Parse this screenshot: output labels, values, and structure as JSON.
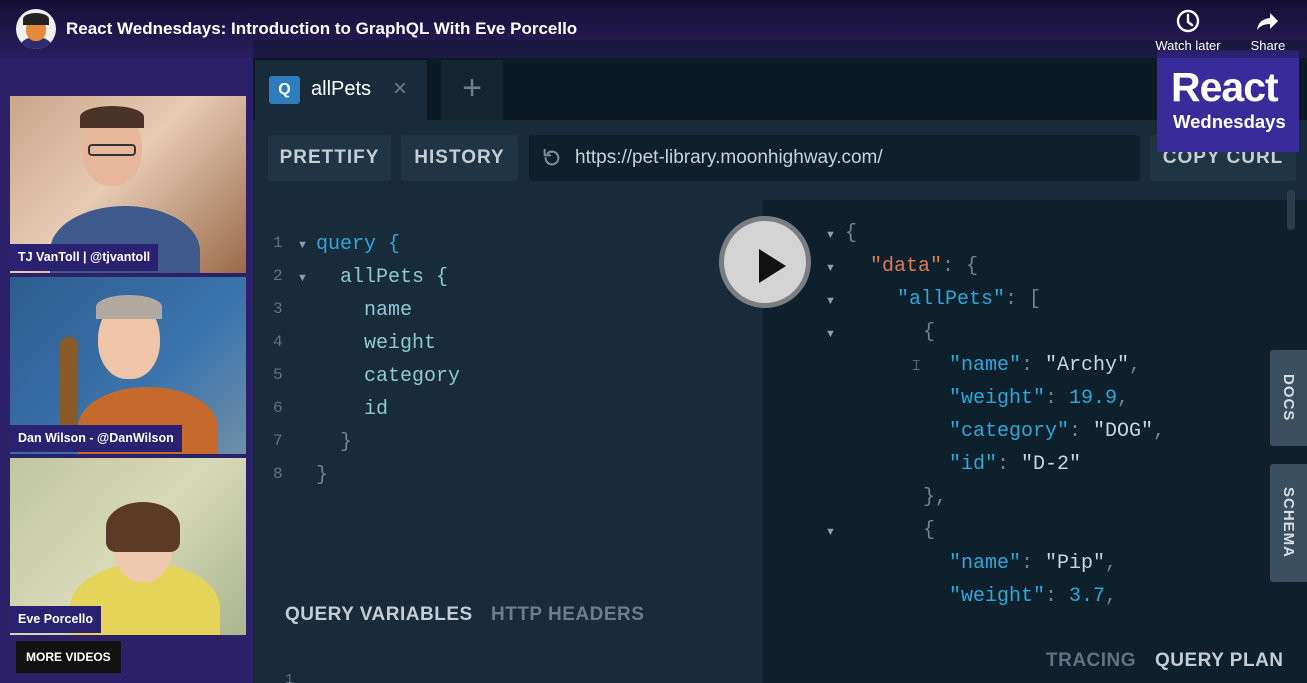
{
  "video": {
    "title": "React Wednesdays: Introduction to GraphQL With Eve Porcello",
    "watch_later_label": "Watch later",
    "share_label": "Share",
    "more_videos_label": "MORE VIDEOS"
  },
  "logo": {
    "line1": "React",
    "line2": "Wednesdays"
  },
  "participants": [
    {
      "name": "TJ VanToll | @tjvantoll"
    },
    {
      "name": "Dan Wilson - @DanWilson"
    },
    {
      "name": "Eve Porcello"
    }
  ],
  "playground": {
    "tab_badge": "Q",
    "tab_label": "allPets",
    "tab_close": "×",
    "add_tab": "+",
    "prettify_label": "PRETTIFY",
    "history_label": "HISTORY",
    "endpoint_url": "https://pet-library.moonhighway.com/",
    "copy_curl_label": "COPY CURL",
    "query_lines": [
      "query {",
      "  allPets {",
      "    name",
      "    weight",
      "    category",
      "    id",
      "  }",
      "}"
    ],
    "line_numbers": [
      "1",
      "2",
      "3",
      "4",
      "5",
      "6",
      "7",
      "8"
    ],
    "query_variables_label": "QUERY VARIABLES",
    "http_headers_label": "HTTP HEADERS",
    "variables_line_number": "1",
    "tracing_label": "TRACING",
    "query_plan_label": "QUERY PLAN",
    "docs_label": "DOCS",
    "schema_label": "SCHEMA",
    "response": {
      "open_brace": "{",
      "data_key": "\"data\"",
      "allpets_key": "\"allPets\"",
      "open_bracket": "[",
      "pets": [
        {
          "name": "\"Archy\"",
          "weight": "19.9",
          "category": "\"DOG\"",
          "id": "\"D-2\""
        },
        {
          "name": "\"Pip\"",
          "weight": "3.7"
        }
      ]
    }
  }
}
